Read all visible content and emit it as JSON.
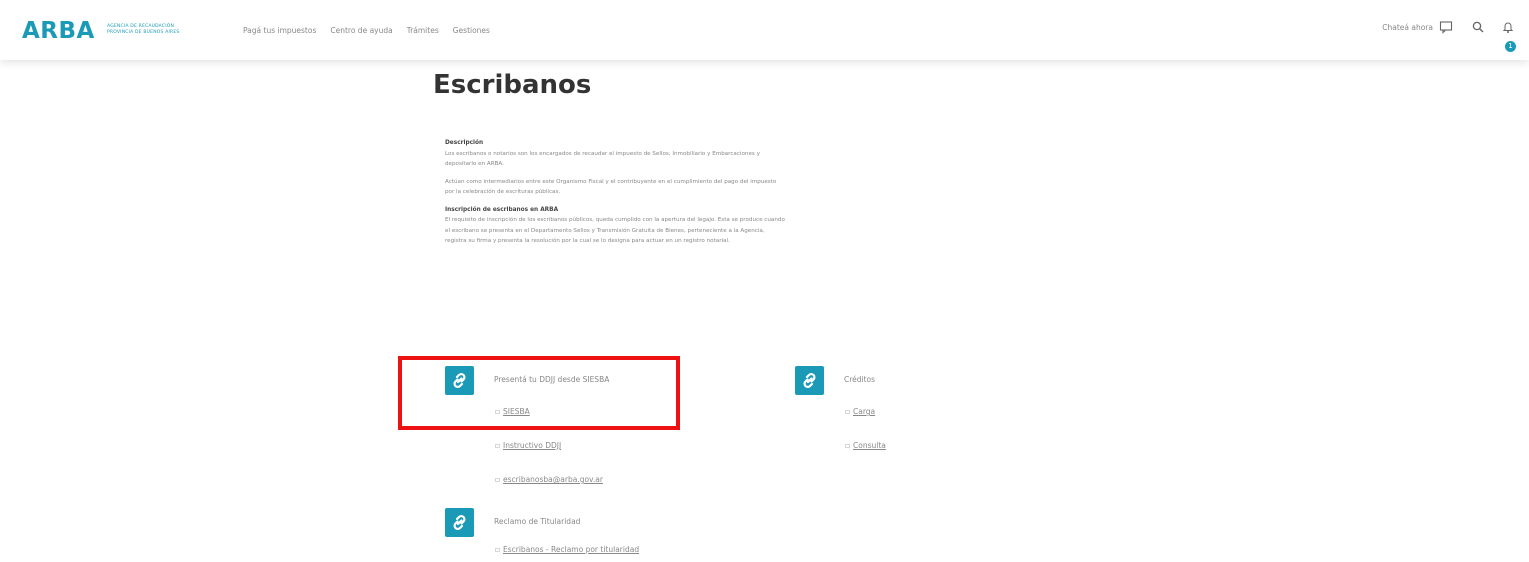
{
  "header": {
    "logo": "ARBA",
    "logo_subtitle": "AGENCIA DE RECAUDACIÓN PROVINCIA DE BUENOS AIRES",
    "nav": [
      {
        "label": "Pagá tus impuestos"
      },
      {
        "label": "Centro de ayuda"
      },
      {
        "label": "Trámites"
      },
      {
        "label": "Gestiones"
      }
    ],
    "chat_label": "Chateá ahora",
    "notification_count": "1"
  },
  "page": {
    "title": "Escribanos"
  },
  "content": {
    "description_heading": "Descripción",
    "description_p1": "Los escribanos o notarios son los encargados de recaudar el impuesto de Sellos, Inmobiliario y Embarcaciones y depositarlo en ARBA.",
    "description_p2": "Actúan como intermediarios entre este Organismo Fiscal y el contribuyente en el cumplimiento del pago del impuesto por la celebración de escrituras públicas.",
    "inscription_heading": "Inscripción de escribanos en ARBA",
    "inscription_p": "El requisito de inscripción de los escribanos públicos, queda cumplido con la apertura del legajo. Esta se produce cuando el escribano se presenta en el Departamento Sellos y Transmisión Gratuita de Bienes, perteneciente a la Agencia, registra su firma y presenta la resolución por la cual se lo designa para actuar en un registro notarial."
  },
  "links": {
    "siesba": {
      "title": "Presentá tu DDJJ desde SIESBA",
      "items": [
        "SIESBA",
        "Instructivo DDJJ",
        "escribanosba@arba.gov.ar"
      ]
    },
    "creditos": {
      "title": "Créditos",
      "items": [
        "Carga",
        "Consulta"
      ]
    },
    "reclamo": {
      "title": "Reclamo de Titularidad",
      "items": [
        "Escribanos - Reclamo por titularidad"
      ]
    }
  },
  "colors": {
    "accent": "#1a9ab7",
    "highlight": "#ee1111"
  }
}
